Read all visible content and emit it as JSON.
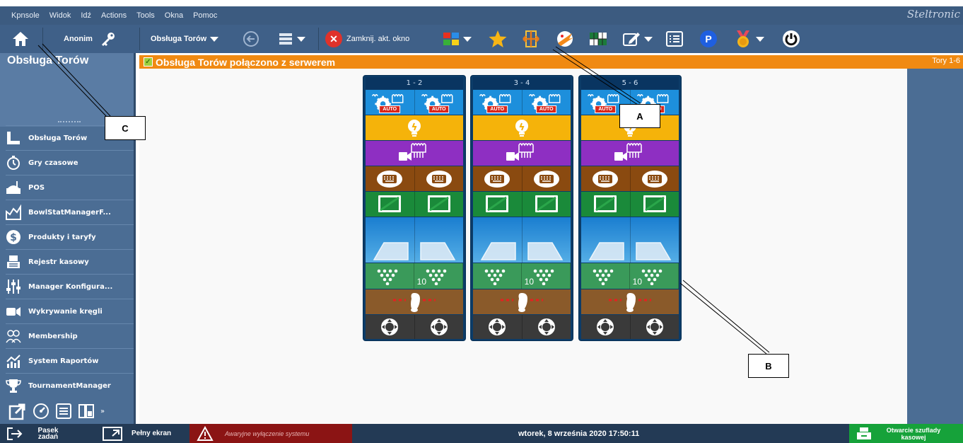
{
  "menu": [
    "Kpnsole",
    "Widok",
    "Idź",
    "Actions",
    "Tools",
    "Okna",
    "Pomoc"
  ],
  "brand": "Steltronic",
  "toolbar": {
    "user": "Anonim",
    "module": "Obsługa Torów",
    "close_window": "Zamknij. akt. okno",
    "icons": [
      "home-icon",
      "key-icon",
      "back-arrow-icon",
      "list-view-icon",
      "close-icon",
      "color-layout-icon",
      "star-icon",
      "lane-split-icon",
      "bowling-strike-icon",
      "lane-grid-icon",
      "edit-icon",
      "list-icon",
      "parking-icon",
      "medal-icon",
      "power-icon"
    ],
    "colors": {
      "close": "#e0322a",
      "parking": "#1f5fe0",
      "star": "#f7b515"
    }
  },
  "sidebar": {
    "title": "Obsługa Torów",
    "items": [
      {
        "label": "Obsługa Torów",
        "icon": "lanes-icon"
      },
      {
        "label": "Gry czasowe",
        "icon": "stopwatch-icon"
      },
      {
        "label": "POS",
        "icon": "pos-icon"
      },
      {
        "label": "BowlStatManagerF...",
        "icon": "stats-chart-icon"
      },
      {
        "label": "Produkty i taryfy",
        "icon": "dollar-icon"
      },
      {
        "label": "Rejestr kasowy",
        "icon": "cash-register-icon"
      },
      {
        "label": "Manager Konfigura...",
        "icon": "sliders-icon"
      },
      {
        "label": "Wykrywanie kręgli",
        "icon": "camera-icon"
      },
      {
        "label": "Membership",
        "icon": "people-icon"
      },
      {
        "label": "System Raportów",
        "icon": "report-chart-icon"
      },
      {
        "label": "TournamentManager",
        "icon": "trophy-icon"
      }
    ]
  },
  "header": {
    "connection": "Obsługa Torów połączono z serwerem",
    "lanes_range": "Tory 1-6"
  },
  "lanes": [
    {
      "label": "1 - 2"
    },
    {
      "label": "3 - 4"
    },
    {
      "label": "5 - 6"
    }
  ],
  "lane_rows": {
    "auto_badge": "AUTO",
    "pins_count": "10"
  },
  "callouts": {
    "a": "A",
    "b": "B",
    "c": "C"
  },
  "statusbar": {
    "taskbar": "Pasek zadań",
    "fullscreen": "Pełny ekran",
    "emergency": "Awaryjne wyłączenie systemu",
    "datetime": "wtorek, 8 września 2020 17:50:11",
    "drawer": "Otwarcie szuflady kasowej"
  }
}
